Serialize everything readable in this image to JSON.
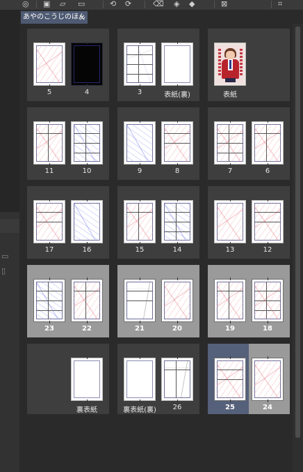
{
  "tab": {
    "title": "あやのこうじのほん",
    "close": "×"
  },
  "toolbar": {
    "icons": [
      "layers-icon",
      "add-page-icon",
      "eraser-icon",
      "folder-icon",
      "undo-icon",
      "redo-icon",
      "clear-icon",
      "fill-icon",
      "shape-icon",
      "select-icon",
      "crop-icon"
    ]
  },
  "spreads": [
    {
      "row": 0,
      "col": 0,
      "selected": false,
      "left": {
        "label": "5",
        "kind": "red"
      },
      "right": {
        "label": "4",
        "kind": "black"
      }
    },
    {
      "row": 0,
      "col": 1,
      "selected": false,
      "left": {
        "label": "3",
        "kind": "faint"
      },
      "right": {
        "label": "表紙(裏)",
        "kind": "blank"
      }
    },
    {
      "row": 0,
      "col": 2,
      "selected": false,
      "left": {
        "label": "表紙",
        "kind": "cover"
      },
      "right": null
    },
    {
      "row": 1,
      "col": 0,
      "selected": false,
      "left": {
        "label": "11",
        "kind": "red"
      },
      "right": {
        "label": "10",
        "kind": "blue"
      }
    },
    {
      "row": 1,
      "col": 1,
      "selected": false,
      "left": {
        "label": "9",
        "kind": "blue"
      },
      "right": {
        "label": "8",
        "kind": "red"
      }
    },
    {
      "row": 1,
      "col": 2,
      "selected": false,
      "left": {
        "label": "7",
        "kind": "red"
      },
      "right": {
        "label": "6",
        "kind": "red"
      }
    },
    {
      "row": 2,
      "col": 0,
      "selected": false,
      "left": {
        "label": "17",
        "kind": "red"
      },
      "right": {
        "label": "16",
        "kind": "blue"
      }
    },
    {
      "row": 2,
      "col": 1,
      "selected": false,
      "left": {
        "label": "15",
        "kind": "red"
      },
      "right": {
        "label": "14",
        "kind": "blue"
      }
    },
    {
      "row": 2,
      "col": 2,
      "selected": false,
      "left": {
        "label": "13",
        "kind": "red"
      },
      "right": {
        "label": "12",
        "kind": "red"
      }
    },
    {
      "row": 3,
      "col": 0,
      "selected": true,
      "left": {
        "label": "23",
        "kind": "blue"
      },
      "right": {
        "label": "22",
        "kind": "red"
      }
    },
    {
      "row": 3,
      "col": 1,
      "selected": true,
      "left": {
        "label": "21",
        "kind": "gray"
      },
      "right": {
        "label": "20",
        "kind": "red"
      }
    },
    {
      "row": 3,
      "col": 2,
      "selected": true,
      "left": {
        "label": "19",
        "kind": "red"
      },
      "right": {
        "label": "18",
        "kind": "red"
      }
    },
    {
      "row": 4,
      "col": 0,
      "selected": false,
      "left": null,
      "right": {
        "label": "裏表紙",
        "kind": "blank"
      }
    },
    {
      "row": 4,
      "col": 1,
      "selected": false,
      "left": {
        "label": "裏表紙(裏)",
        "kind": "blank"
      },
      "right": {
        "label": "26",
        "kind": "gray"
      }
    },
    {
      "row": 4,
      "col": 2,
      "selected": true,
      "active_left": true,
      "left": {
        "label": "25",
        "kind": "red"
      },
      "right": {
        "label": "24",
        "kind": "red"
      }
    }
  ]
}
